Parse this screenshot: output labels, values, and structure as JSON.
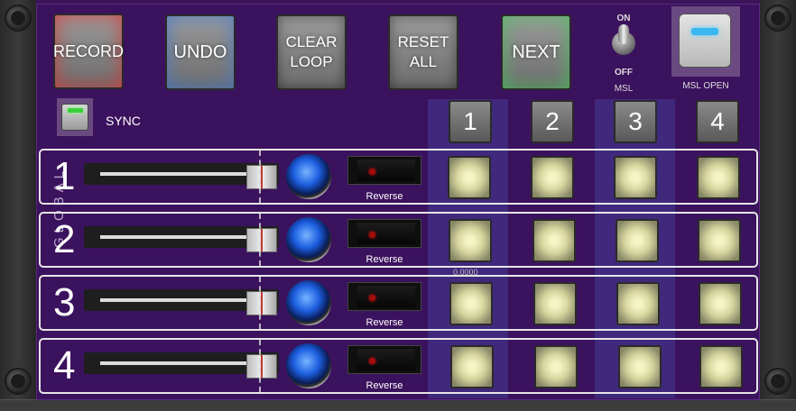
{
  "panel": {
    "section_label": "GLOBAL",
    "background_color": "#3b125e"
  },
  "buttons": {
    "record": "RECORD",
    "undo": "UNDO",
    "clear_loop_line1": "CLEAR",
    "clear_loop_line2": "LOOP",
    "reset_all_line1": "RESET",
    "reset_all_line2": "ALL",
    "next": "NEXT"
  },
  "msl_toggle": {
    "on_label": "ON",
    "off_label": "OFF",
    "label": "MSL",
    "state": "on"
  },
  "msl_open": {
    "label": "MSL OPEN",
    "led_color": "#39b7f0"
  },
  "sync": {
    "label": "SYNC",
    "led_color": "#3ccf3c"
  },
  "column_headers": [
    "1",
    "2",
    "3",
    "4"
  ],
  "rows": [
    {
      "number": "1",
      "reverse_label": "Reverse"
    },
    {
      "number": "2",
      "reverse_label": "Reverse"
    },
    {
      "number": "3",
      "reverse_label": "Reverse"
    },
    {
      "number": "4",
      "reverse_label": "Reverse"
    }
  ],
  "pad_readout": "0.0000",
  "icons": {
    "level_led": "blue-led-icon",
    "reverse_indicator": "red-dot-icon",
    "screw": "rack-screw-icon"
  }
}
